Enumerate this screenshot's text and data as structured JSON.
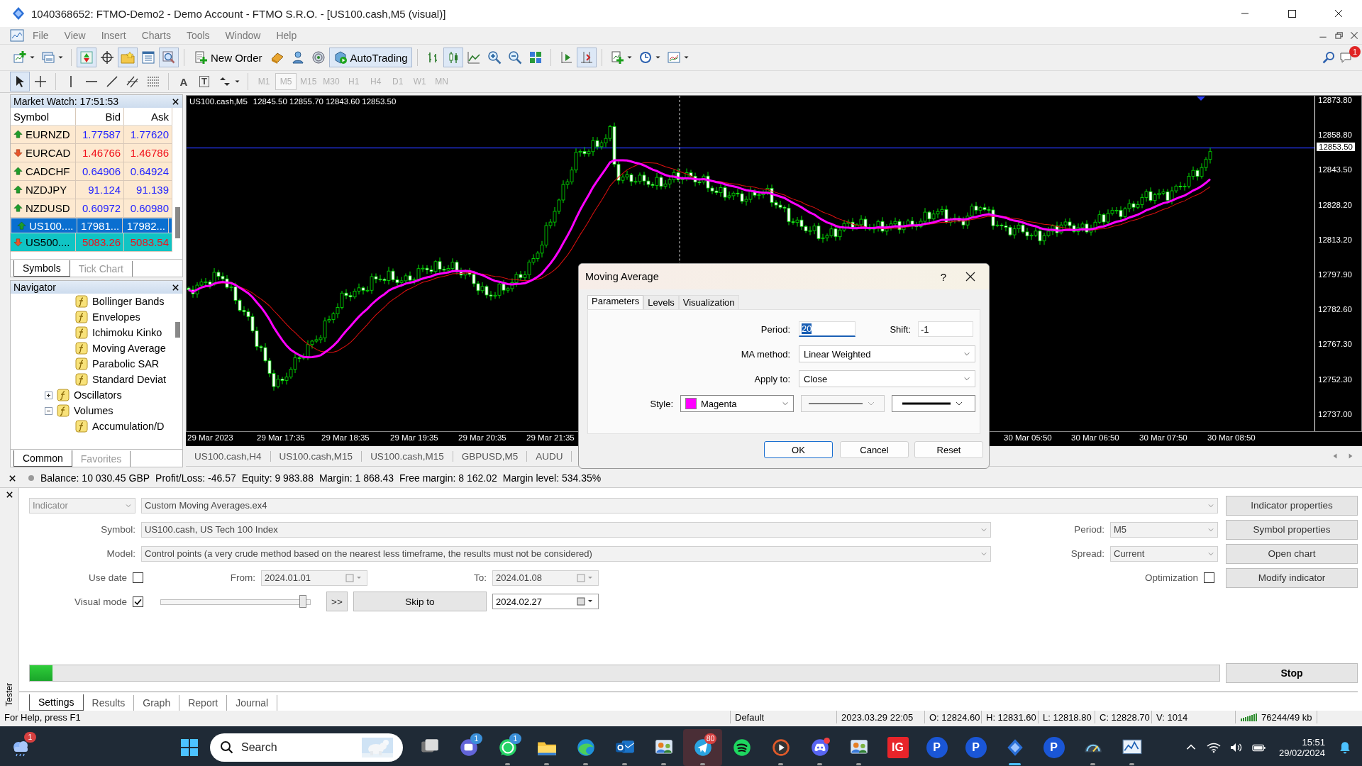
{
  "window": {
    "title": "1040368652: FTMO-Demo2 - Demo Account - FTMO S.R.O. - [US100.cash,M5 (visual)]"
  },
  "menu": [
    "File",
    "View",
    "Insert",
    "Charts",
    "Tools",
    "Window",
    "Help"
  ],
  "toolbar": {
    "new_order": "New Order",
    "autotrading": {
      "label": "AutoTrading",
      "on": true
    },
    "notification_badge": "1"
  },
  "drawing_tools": [
    {
      "kind": "cursor",
      "selected": true
    },
    {
      "kind": "crosshair",
      "selected": false
    },
    {
      "kind": "vertical-line",
      "selected": false
    },
    {
      "kind": "horizontal-line",
      "selected": false
    },
    {
      "kind": "trendline",
      "selected": false
    },
    {
      "kind": "channel",
      "selected": false
    },
    {
      "kind": "fibonacci",
      "selected": false
    },
    {
      "kind": "text",
      "glyph": "A",
      "selected": false
    },
    {
      "kind": "label",
      "glyph": "T",
      "selected": false
    },
    {
      "kind": "arrows",
      "selected": false
    }
  ],
  "timeframes": [
    {
      "label": "M1",
      "selected": false,
      "disabled": true
    },
    {
      "label": "M5",
      "selected": true,
      "disabled": true
    },
    {
      "label": "M15",
      "selected": false,
      "disabled": true
    },
    {
      "label": "M30",
      "selected": false,
      "disabled": true
    },
    {
      "label": "H1",
      "selected": false,
      "disabled": true
    },
    {
      "label": "H4",
      "selected": false,
      "disabled": true
    },
    {
      "label": "D1",
      "selected": false,
      "disabled": true
    },
    {
      "label": "W1",
      "selected": false,
      "disabled": true
    },
    {
      "label": "MN",
      "selected": false,
      "disabled": true
    }
  ],
  "market_watch": {
    "title": "Market Watch: 17:51:53",
    "columns": [
      "Symbol",
      "Bid",
      "Ask"
    ],
    "rows": [
      {
        "symbol": "EURNZD",
        "bid": "1.77587",
        "ask": "1.77620",
        "up": true,
        "selected": false,
        "marked": false
      },
      {
        "symbol": "EURCAD",
        "bid": "1.46766",
        "ask": "1.46786",
        "up": false,
        "selected": false,
        "marked": false
      },
      {
        "symbol": "CADCHF",
        "bid": "0.64906",
        "ask": "0.64924",
        "up": true,
        "selected": false,
        "marked": false
      },
      {
        "symbol": "NZDJPY",
        "bid": "91.124",
        "ask": "91.139",
        "up": true,
        "selected": false,
        "marked": false
      },
      {
        "symbol": "NZDUSD",
        "bid": "0.60972",
        "ask": "0.60980",
        "up": true,
        "selected": false,
        "marked": false
      },
      {
        "symbol": "US100....",
        "bid": "17981...",
        "ask": "17982...",
        "up": true,
        "selected": true,
        "marked": false
      },
      {
        "symbol": "US500....",
        "bid": "5083.26",
        "ask": "5083.54",
        "up": false,
        "selected": false,
        "marked": true
      }
    ],
    "tabs": [
      {
        "label": "Symbols",
        "selected": true
      },
      {
        "label": "Tick Chart",
        "selected": false
      }
    ]
  },
  "navigator": {
    "title": "Navigator",
    "tree": [
      {
        "children": [
          {
            "label": "Bollinger Bands"
          },
          {
            "label": "Envelopes"
          },
          {
            "label": "Ichimoku Kinko"
          },
          {
            "label": "Moving Average"
          },
          {
            "label": "Parabolic SAR"
          },
          {
            "label": "Standard Deviat"
          }
        ]
      },
      {
        "label": "Oscillators",
        "expanded": false
      },
      {
        "label": "Volumes",
        "expanded": true,
        "children": [
          {
            "label": "Accumulation/D"
          }
        ]
      }
    ],
    "tabs": [
      {
        "label": "Common",
        "selected": true
      },
      {
        "label": "Favorites",
        "selected": false
      }
    ]
  },
  "chart": {
    "symbol": "US100.cash,M5",
    "ohlc": "12845.50 12855.70 12843.60 12853.50",
    "price_labels": [
      "12873.80",
      "12858.80",
      "12843.50",
      "12828.20",
      "12813.20",
      "12797.90",
      "12782.60",
      "12767.30",
      "12752.30",
      "12737.00"
    ],
    "current_price": "12853.50",
    "time_labels": [
      "29 Mar 2023",
      "29 Mar 17:35",
      "29 Mar 18:35",
      "29 Mar 19:35",
      "29 Mar 20:35",
      "29 Mar 21:35",
      "30 Mar 05:50",
      "30 Mar 06:50",
      "30 Mar 07:50",
      "30 Mar 08:50"
    ]
  },
  "chart_tabs": [
    "US100.cash,H4",
    "US100.cash,M15",
    "US100.cash,M15",
    "GBPUSD,M5",
    "AUDU"
  ],
  "account": [
    "Balance: 10 030.45 GBP",
    "Profit/Loss: -46.57",
    "Equity: 9 983.88",
    "Margin: 1 868.43",
    "Free margin: 8 162.02",
    "Margin level: 534.35%"
  ],
  "dialog": {
    "title": "Moving Average",
    "help": "?",
    "tabs": [
      {
        "label": "Parameters",
        "selected": true
      },
      {
        "label": "Levels",
        "selected": false
      },
      {
        "label": "Visualization",
        "selected": false
      }
    ],
    "period": {
      "label": "Period:",
      "value": "20"
    },
    "shift": {
      "label": "Shift:",
      "value": "-1"
    },
    "ma_method": {
      "label": "MA method:",
      "value": "Linear Weighted"
    },
    "apply_to": {
      "label": "Apply to:",
      "value": "Close"
    },
    "style": {
      "label": "Style:",
      "color_name": "Magenta",
      "color": "#ff00ff"
    },
    "buttons": [
      "OK",
      "Cancel",
      "Reset"
    ]
  },
  "tester": {
    "type": "Indicator",
    "program": "Custom Moving Averages.ex4",
    "symbol": {
      "label": "Symbol:",
      "value": "US100.cash, US Tech 100 Index"
    },
    "model": {
      "label": "Model:",
      "value": "Control points (a very crude method based on the nearest less timeframe, the results must not be considered)"
    },
    "period": {
      "label": "Period:",
      "value": "M5"
    },
    "spread": {
      "label": "Spread:",
      "value": "Current"
    },
    "use_date": {
      "label": "Use date",
      "checked": false
    },
    "from": {
      "label": "From:",
      "value": "2024.01.01"
    },
    "to": {
      "label": "To:",
      "value": "2024.01.08"
    },
    "optimization": {
      "label": "Optimization",
      "checked": false
    },
    "visual_mode": {
      "label": "Visual mode",
      "checked": true
    },
    "speed": {
      "level": 0.98
    },
    "fast_forward": ">>",
    "skip_to": "Skip to",
    "skip_date": "2024.02.27",
    "progress": {
      "level": 0.019
    },
    "buttons": [
      "Indicator properties",
      "Symbol properties",
      "Open chart",
      "Modify indicator"
    ],
    "stop": "Stop",
    "tabs": [
      {
        "label": "Settings",
        "selected": true
      },
      {
        "label": "Results",
        "selected": false
      },
      {
        "label": "Graph",
        "selected": false
      },
      {
        "label": "Report",
        "selected": false
      },
      {
        "label": "Journal",
        "selected": false
      }
    ],
    "side_label": "Tester"
  },
  "status_bar": [
    "For Help, press F1",
    "Default",
    "2023.03.29 22:05",
    "O: 12824.60",
    "H: 12831.60",
    "L: 12818.80",
    "C: 12828.70",
    "V: 1014",
    "76244/49 kb"
  ],
  "taskbar": {
    "weather_badge": "1",
    "search": "Search",
    "apps": [
      {
        "kind": "taskview",
        "running": false,
        "active": false,
        "highlighted": false
      },
      {
        "kind": "teams",
        "badge": "1",
        "running": false,
        "active": false,
        "highlighted": false
      },
      {
        "kind": "whatsapp",
        "badge": "1",
        "running": true,
        "active": false,
        "highlighted": false
      },
      {
        "kind": "files",
        "running": true,
        "active": false,
        "highlighted": false
      },
      {
        "kind": "edge",
        "running": true,
        "active": false,
        "highlighted": false
      },
      {
        "kind": "outlook",
        "running": true,
        "active": false,
        "highlighted": false
      },
      {
        "kind": "people",
        "running": true,
        "active": false,
        "highlighted": false
      },
      {
        "kind": "telegram",
        "badge": "80",
        "running": true,
        "active": false,
        "highlighted": true
      },
      {
        "kind": "spotify",
        "running": false,
        "active": false,
        "highlighted": false
      },
      {
        "kind": "player",
        "running": true,
        "active": false,
        "highlighted": false
      },
      {
        "kind": "discord",
        "running": true,
        "active": false,
        "highlighted": false
      },
      {
        "kind": "people",
        "running": true,
        "active": false,
        "highlighted": false
      },
      {
        "kind": "ig",
        "label": "IG",
        "running": false,
        "active": false,
        "highlighted": false
      },
      {
        "kind": "p",
        "label": "P",
        "running": false,
        "active": false,
        "highlighted": false
      },
      {
        "kind": "p",
        "label": "P",
        "running": false,
        "active": false,
        "highlighted": false
      },
      {
        "kind": "metatrader",
        "running": true,
        "active": true,
        "highlighted": false
      },
      {
        "kind": "p",
        "label": "P",
        "running": false,
        "active": false,
        "highlighted": false
      },
      {
        "kind": "gauge",
        "running": true,
        "active": false,
        "highlighted": false
      },
      {
        "kind": "monitor",
        "running": true,
        "active": false,
        "highlighted": false
      }
    ],
    "time": "15:51",
    "date": "29/02/2024"
  }
}
